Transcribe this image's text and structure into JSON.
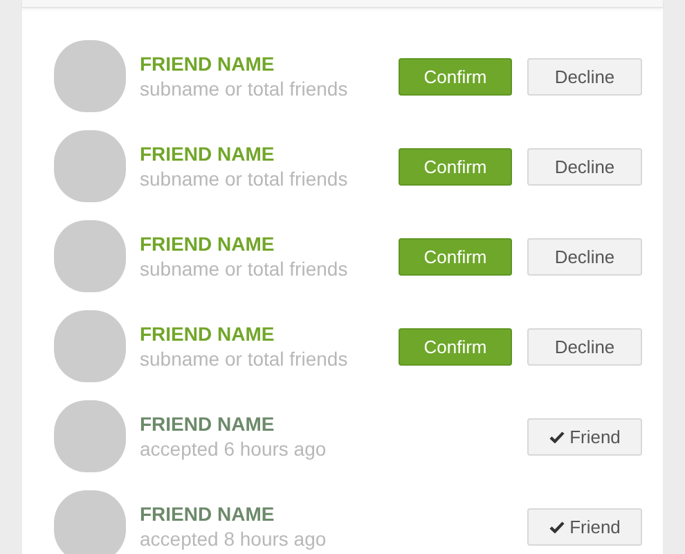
{
  "friends": [
    {
      "kind": "request",
      "name": "FRIEND NAME",
      "subtitle": "subname or total friends",
      "confirm": "Confirm",
      "decline": "Decline"
    },
    {
      "kind": "request",
      "name": "FRIEND NAME",
      "subtitle": "subname or total friends",
      "confirm": "Confirm",
      "decline": "Decline"
    },
    {
      "kind": "request",
      "name": "FRIEND NAME",
      "subtitle": "subname or total friends",
      "confirm": "Confirm",
      "decline": "Decline"
    },
    {
      "kind": "request",
      "name": "FRIEND NAME",
      "subtitle": "subname or total friends",
      "confirm": "Confirm",
      "decline": "Decline"
    },
    {
      "kind": "friend",
      "name": "FRIEND NAME",
      "subtitle": "accepted 6 hours ago",
      "status": "Friend"
    },
    {
      "kind": "friend",
      "name": "FRIEND NAME",
      "subtitle": "accepted 8 hours ago",
      "status": "Friend"
    }
  ]
}
